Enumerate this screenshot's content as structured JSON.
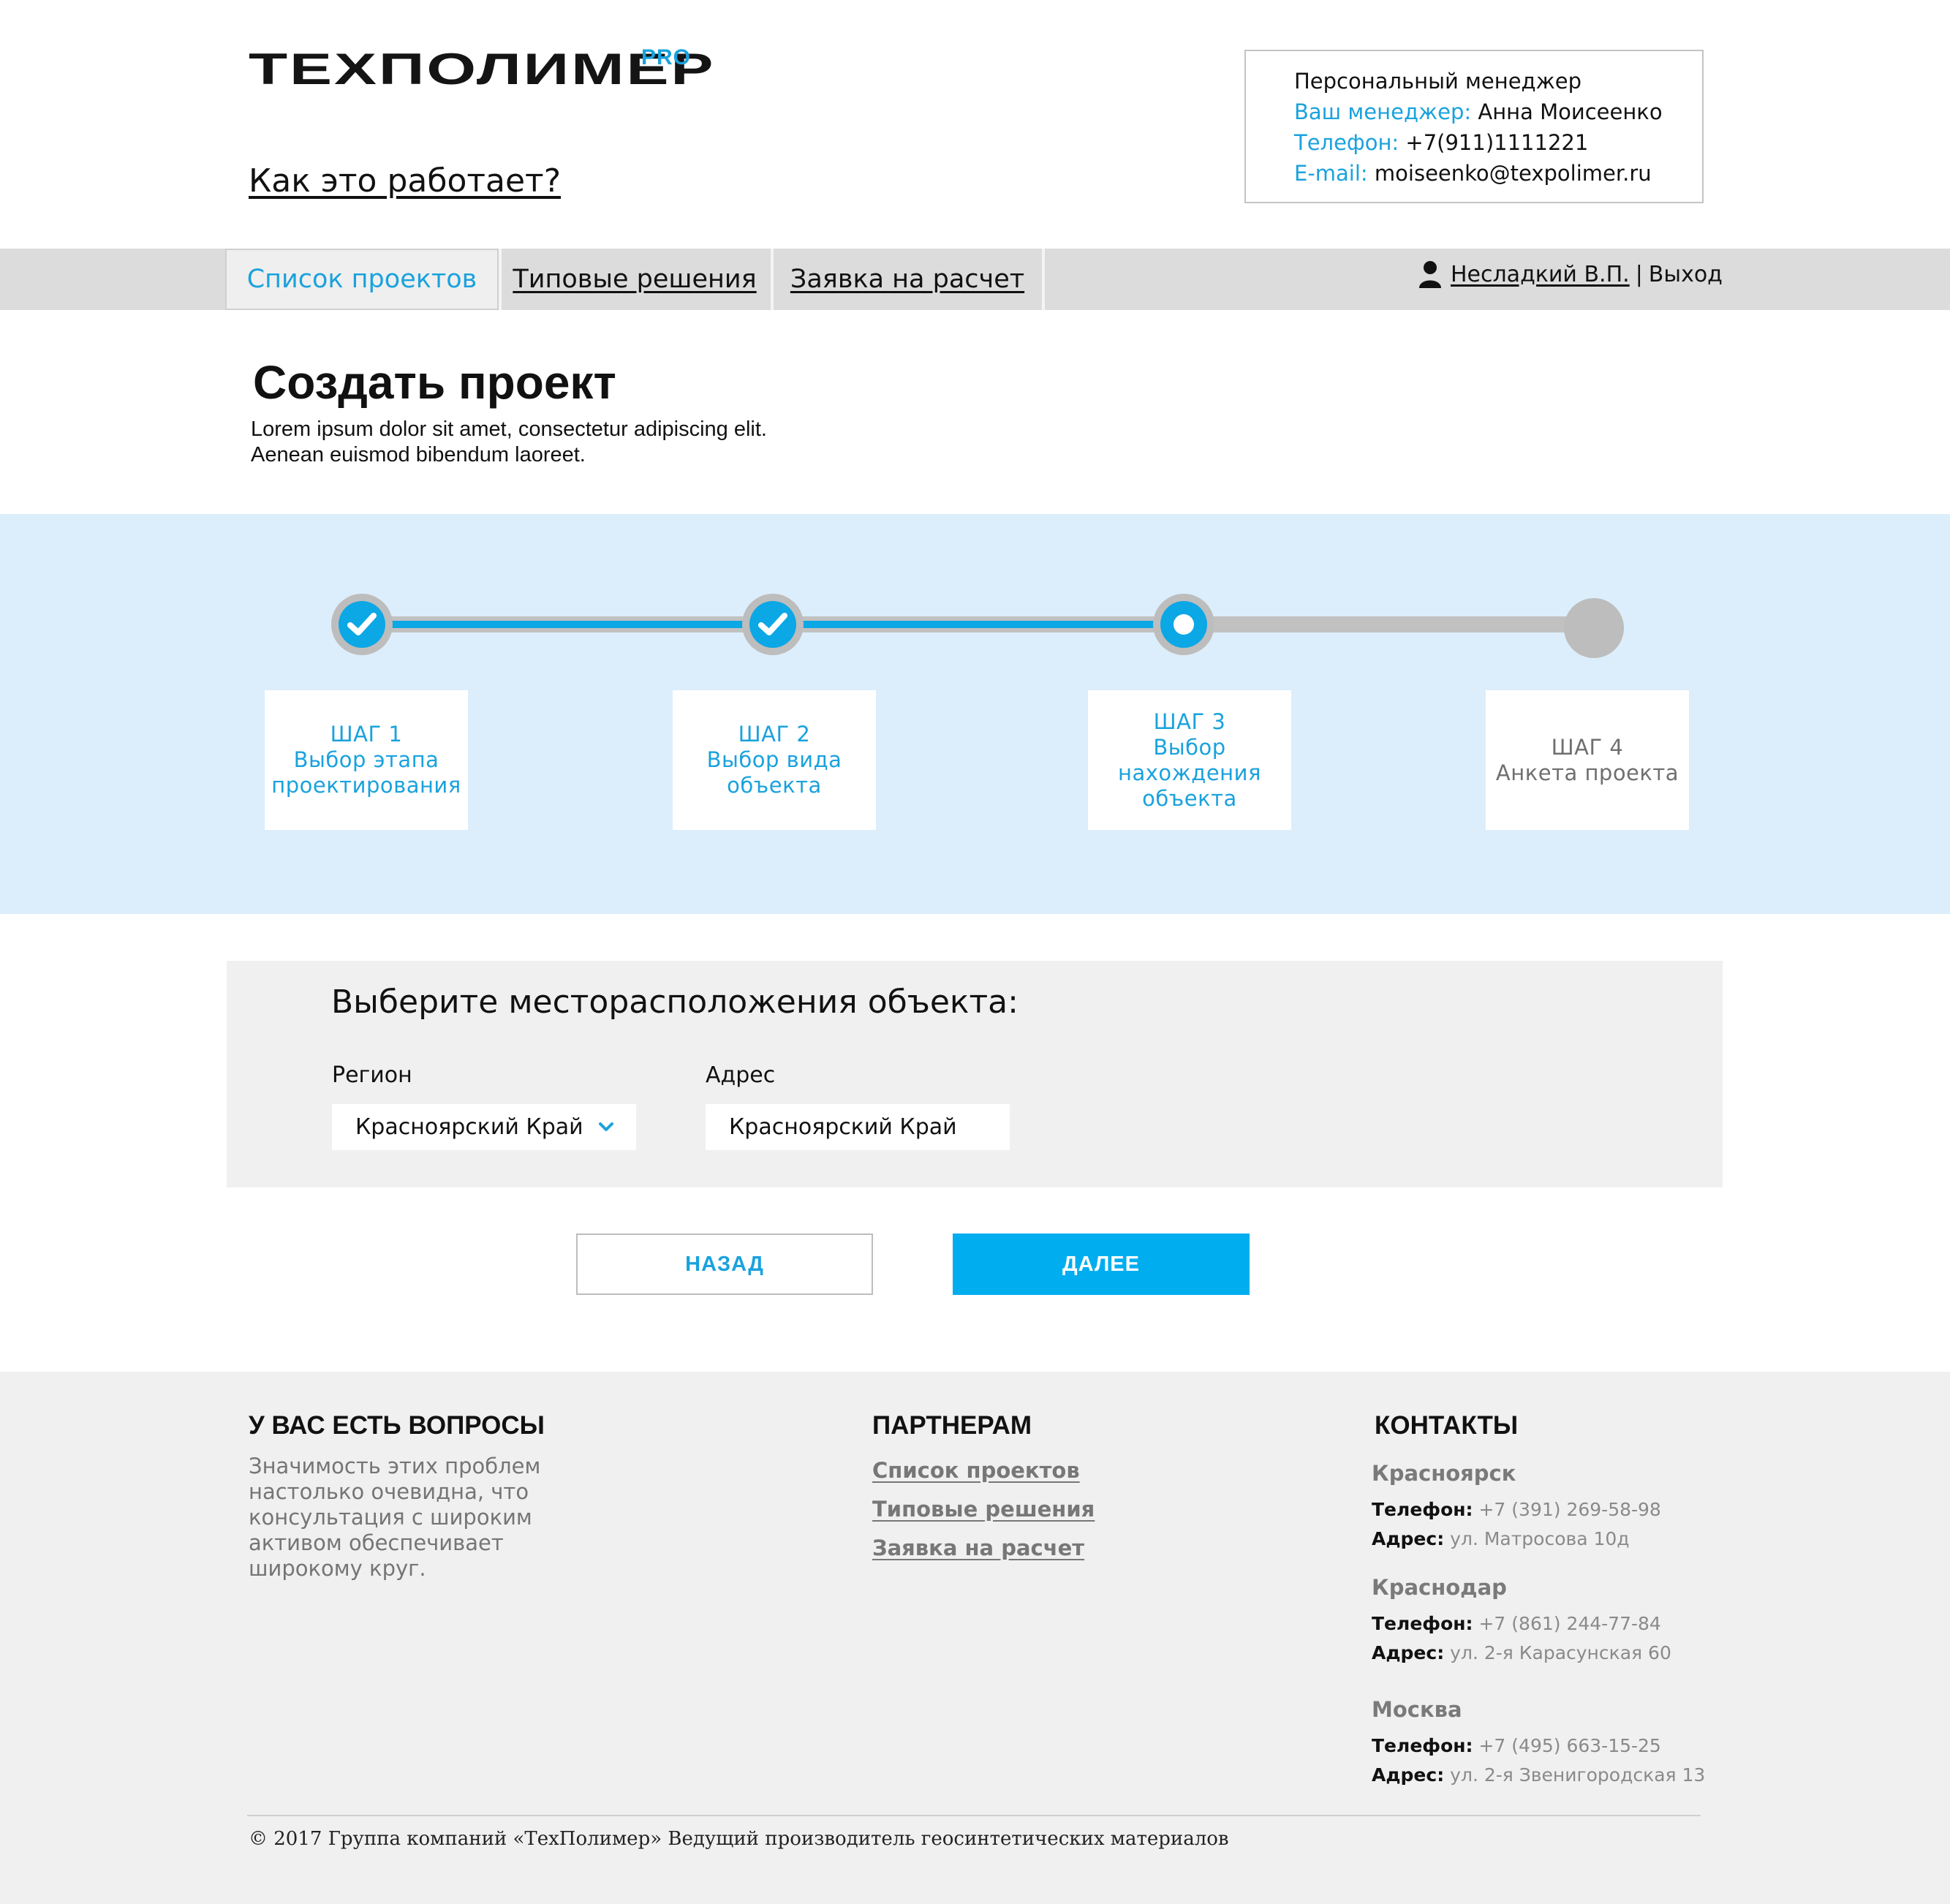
{
  "brand": {
    "logo": "ТЕХПОЛИМЕР",
    "logo_suffix": "PRO"
  },
  "header": {
    "how_it_works": "Как это работает?",
    "manager": {
      "title": "Персональный менеджер",
      "name_label": "Ваш менеджер:",
      "name": "Анна Моисеенко",
      "phone_label": "Телефон:",
      "phone": "+7(911)1111221",
      "email_label": "E-mail:",
      "email": "moiseenko@texpolimer.ru"
    }
  },
  "nav": {
    "tabs": [
      {
        "label": "Список проектов",
        "active": true
      },
      {
        "label": "Типовые решения",
        "active": false
      },
      {
        "label": "Заявка на расчет",
        "active": false
      }
    ],
    "user_name": "Несладкий В.П.",
    "separator": "|",
    "logout": "Выход"
  },
  "page": {
    "title": "Создать проект",
    "desc_line1": "Lorem ipsum dolor sit amet, consectetur adipiscing elit.",
    "desc_line2": "Aenean euismod bibendum laoreet."
  },
  "stepper": {
    "current_step": 3,
    "steps": [
      {
        "num": "ШАГ 1",
        "lines": [
          "Выбор этапа",
          "проектирования"
        ],
        "state": "done"
      },
      {
        "num": "ШАГ 2",
        "lines": [
          "Выбор вида",
          "объекта"
        ],
        "state": "done"
      },
      {
        "num": "ШАГ 3",
        "lines": [
          "Выбор",
          "нахождения",
          "объекта"
        ],
        "state": "current"
      },
      {
        "num": "ШАГ 4",
        "lines": [
          "Анкета проекта"
        ],
        "state": "todo"
      }
    ]
  },
  "form": {
    "heading": "Выберите месторасположения объекта:",
    "region_label": "Регион",
    "region_value": "Красноярский Край",
    "address_label": "Адрес",
    "address_value": "Красноярский Край"
  },
  "buttons": {
    "back": "НАЗАД",
    "next": "ДАЛЕЕ"
  },
  "footer": {
    "questions_title": "У ВАС ЕСТЬ ВОПРОСЫ",
    "questions_text": "Значимость этих проблем настолько очевидна, что консультация с широким активом обеспечивает широкому круг.",
    "partners_title": "ПАРТНЕРАМ",
    "partner_links": [
      "Список проектов",
      "Типовые решения",
      "Заявка на расчет"
    ],
    "contacts_title": "КОНТАКТЫ",
    "phone_label": "Телефон:",
    "address_label": "Адрес:",
    "cities": [
      {
        "name": "Красноярск",
        "phone": "+7 (391) 269-58-98",
        "address": "ул. Матросова 10д"
      },
      {
        "name": "Краснодар",
        "phone": "+7 (861) 244-77-84",
        "address": "ул. 2-я Карасунская 60"
      },
      {
        "name": "Москва",
        "phone": "+7 (495) 663-15-25",
        "address": "ул. 2-я Звенигородская 13"
      }
    ],
    "copyright": "© 2017 Группа компаний «ТехПолимер» Ведущий производитель геосинтетических материалов"
  },
  "colors": {
    "accent": "#1aa2dd",
    "button_primary": "#00adef",
    "stepper_band": "#dceefb",
    "nav_bg": "#dcdcdc",
    "footer_bg": "#f0f0f0"
  },
  "icons": {
    "user": "user-icon",
    "check": "check-icon",
    "chevron": "chevron-down-icon"
  }
}
